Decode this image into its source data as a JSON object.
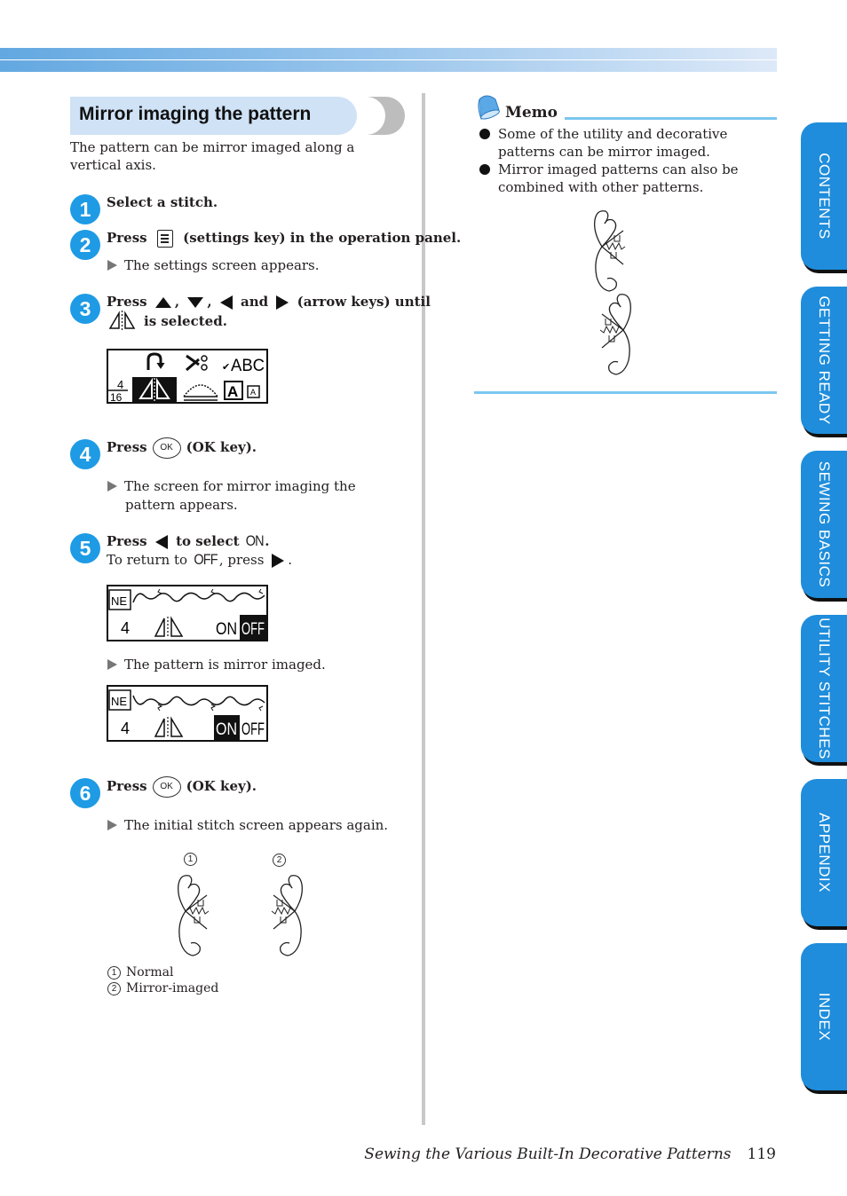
{
  "section": {
    "title": "Mirror imaging the pattern",
    "intro": "The pattern can be mirror imaged along a vertical axis."
  },
  "steps": [
    {
      "num": "1",
      "title": "Select a stitch."
    },
    {
      "num": "2",
      "title_pre": "Press",
      "title_post": "(settings key) in the operation panel.",
      "result": "The settings screen appears."
    },
    {
      "num": "3",
      "title_pre": "Press",
      "sep1": ",",
      "sep2": ",",
      "and": "and",
      "title_post": "(arrow keys) until",
      "line2": "is selected."
    },
    {
      "num": "4",
      "title_pre": "Press",
      "key": "OK",
      "title_post": "(OK key).",
      "result": "The screen for mirror imaging the pattern appears."
    },
    {
      "num": "5",
      "title_pre": "Press",
      "title_mid": "to select",
      "on_word": "ON",
      "period": ".",
      "line2_pre": "To return to",
      "off_word": "OFF",
      "line2_mid": ", press",
      "line2_end": ".",
      "result": "The pattern is mirror imaged."
    },
    {
      "num": "6",
      "title_pre": "Press",
      "key": "OK",
      "title_post": "(OK key).",
      "result": "The initial stitch screen appears again."
    }
  ],
  "lcd_settings": {
    "fraction_top": "4",
    "fraction_bottom": "16",
    "abc_label": "ABC",
    "check": "✔",
    "letter": "A"
  },
  "lcd_mirror": {
    "badge": "NE",
    "number": "4",
    "on": "ON",
    "off": "OFF",
    "before_selected": "OFF",
    "after_selected": "ON"
  },
  "figure": {
    "labels": [
      {
        "num": "1",
        "text": "Normal"
      },
      {
        "num": "2",
        "text": "Mirror-imaged"
      }
    ]
  },
  "memo": {
    "title": "Memo",
    "items": [
      "Some of the utility and decorative patterns can be mirror imaged.",
      "Mirror imaged patterns can also be combined with other patterns."
    ]
  },
  "side_tabs": [
    "CONTENTS",
    "GETTING READY",
    "SEWING BASICS",
    "UTILITY STITCHES",
    "APPENDIX",
    "INDEX"
  ],
  "footer": {
    "chapter": "Sewing the Various Built-In Decorative Patterns",
    "page": "119"
  },
  "colors": {
    "accent": "#1e9be4",
    "tab": "#1f8ddb",
    "heading_bg": "#cfe2f6",
    "memo_rule": "#7cc6f0"
  }
}
